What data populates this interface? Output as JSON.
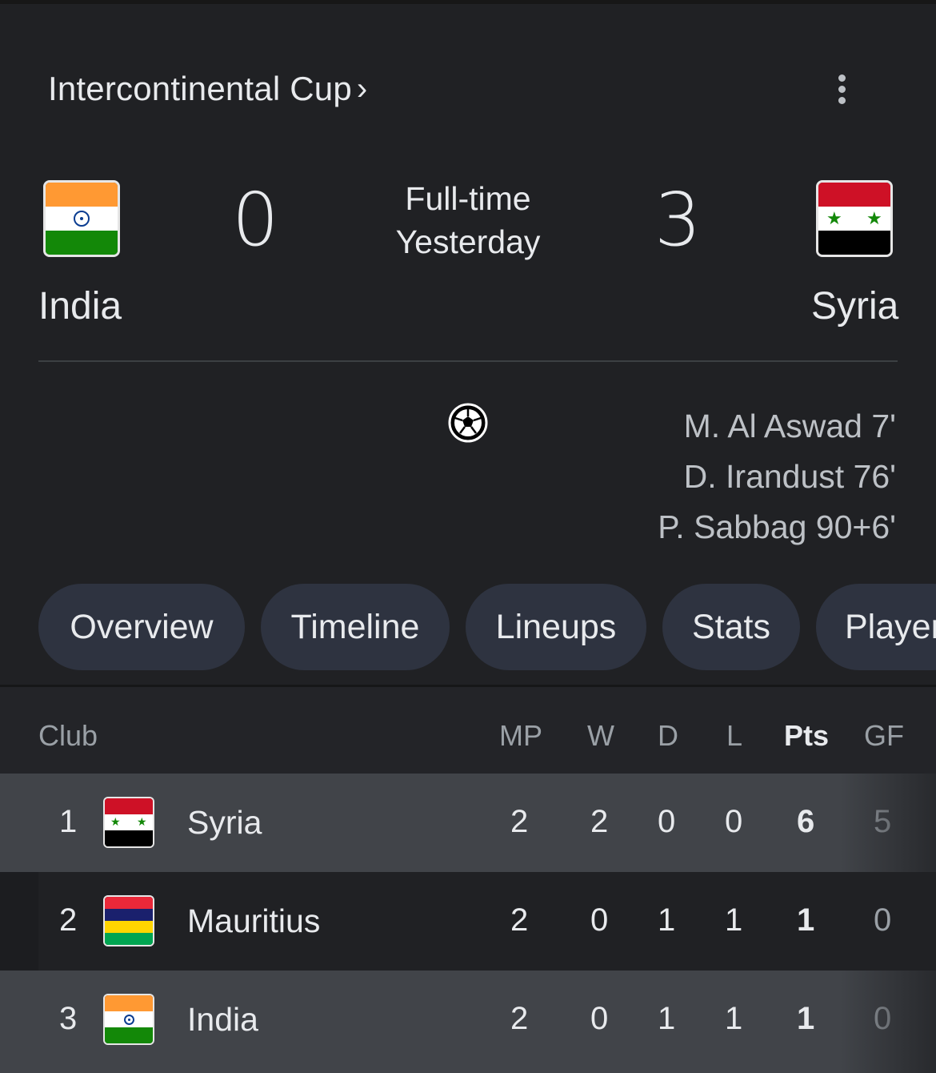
{
  "header": {
    "competition": "Intercontinental Cup",
    "chevron": "›",
    "more_icon": "more-vert-icon"
  },
  "match": {
    "home": {
      "name": "India",
      "score": "0"
    },
    "away": {
      "name": "Syria",
      "score": "3"
    },
    "status_line1": "Full-time",
    "status_line2": "Yesterday",
    "goal_icon": "soccer-ball-icon",
    "away_scorers": [
      "M. Al Aswad 7'",
      "D. Irandust 76'",
      "P. Sabbag 90+6'"
    ]
  },
  "tabs": [
    "Overview",
    "Timeline",
    "Lineups",
    "Stats",
    "Players"
  ],
  "standings": {
    "headers": {
      "club": "Club",
      "mp": "MP",
      "w": "W",
      "d": "D",
      "l": "L",
      "pts": "Pts",
      "gf": "GF"
    },
    "rows": [
      {
        "rank": "1",
        "team": "Syria",
        "mp": "2",
        "w": "2",
        "d": "0",
        "l": "0",
        "pts": "6",
        "gf": "5"
      },
      {
        "rank": "2",
        "team": "Mauritius",
        "mp": "2",
        "w": "0",
        "d": "1",
        "l": "1",
        "pts": "1",
        "gf": "0"
      },
      {
        "rank": "3",
        "team": "India",
        "mp": "2",
        "w": "0",
        "d": "1",
        "l": "1",
        "pts": "1",
        "gf": "0"
      }
    ]
  },
  "colors": {
    "background": "#202124",
    "tab_bg": "#2e3340",
    "highlight_row": "#414449",
    "india_saffron": "#ff9933",
    "india_green": "#138808",
    "syria_red": "#ce1126",
    "mauritius_red": "#ea2839",
    "mauritius_blue": "#1a206d",
    "mauritius_yellow": "#ffd500",
    "mauritius_green": "#00a551"
  }
}
